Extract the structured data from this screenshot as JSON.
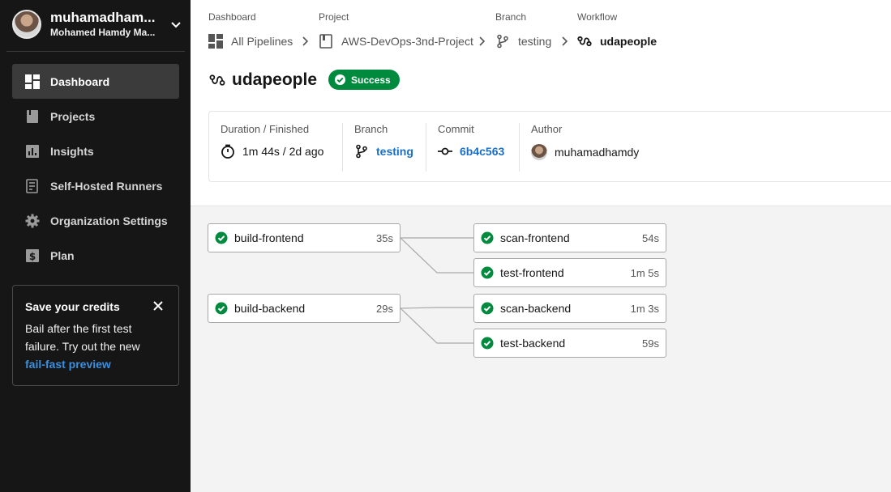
{
  "user": {
    "username": "muhamadham...",
    "full_name": "Mohamed Hamdy Ma..."
  },
  "nav": [
    {
      "label": "Dashboard",
      "icon": "dashboard-icon",
      "active": true
    },
    {
      "label": "Projects",
      "icon": "projects-icon",
      "active": false
    },
    {
      "label": "Insights",
      "icon": "insights-icon",
      "active": false
    },
    {
      "label": "Self-Hosted Runners",
      "icon": "runners-icon",
      "active": false
    },
    {
      "label": "Organization Settings",
      "icon": "gear-icon",
      "active": false
    },
    {
      "label": "Plan",
      "icon": "dollar-icon",
      "active": false
    }
  ],
  "promo": {
    "title": "Save your credits",
    "body": "Bail after the first test failure. Try out the new",
    "link": "fail-fast preview"
  },
  "breadcrumb": {
    "dashboard": {
      "label": "Dashboard",
      "value": "All Pipelines"
    },
    "project": {
      "label": "Project",
      "value": "AWS-DevOps-3nd-Project"
    },
    "branch": {
      "label": "Branch",
      "value": "testing"
    },
    "workflow": {
      "label": "Workflow",
      "value": "udapeople"
    }
  },
  "workflow": {
    "name": "udapeople",
    "status": "Success"
  },
  "meta": {
    "duration": {
      "label": "Duration / Finished",
      "value": "1m 44s / 2d ago"
    },
    "branch": {
      "label": "Branch",
      "value": "testing"
    },
    "commit": {
      "label": "Commit",
      "value": "6b4c563"
    },
    "author": {
      "label": "Author",
      "value": "muhamadhamdy"
    }
  },
  "jobs": [
    {
      "name": "build-frontend",
      "duration": "35s",
      "status": "success"
    },
    {
      "name": "scan-frontend",
      "duration": "54s",
      "status": "success"
    },
    {
      "name": "test-frontend",
      "duration": "1m 5s",
      "status": "success"
    },
    {
      "name": "build-backend",
      "duration": "29s",
      "status": "success"
    },
    {
      "name": "scan-backend",
      "duration": "1m 3s",
      "status": "success"
    },
    {
      "name": "test-backend",
      "duration": "59s",
      "status": "success"
    }
  ],
  "colors": {
    "success": "#008a3e",
    "sidebar": "#161616",
    "link": "#1a6fc4",
    "promo_link": "#3a8fe0"
  }
}
